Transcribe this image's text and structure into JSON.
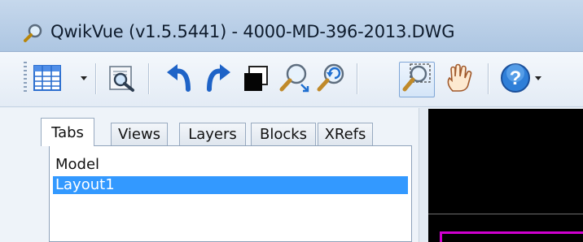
{
  "window": {
    "title": "QwikVue (v1.5.5441) - 4000-MD-396-2013.DWG"
  },
  "toolbar": {
    "buttons": [
      {
        "icon": "grid-table-icon"
      },
      {
        "icon": "print-preview-icon"
      },
      {
        "icon": "undo-icon"
      },
      {
        "icon": "redo-icon"
      },
      {
        "icon": "black-white-icon"
      },
      {
        "icon": "zoom-extents-icon"
      },
      {
        "icon": "zoom-previous-icon"
      },
      {
        "icon": "zoom-window-icon"
      },
      {
        "icon": "pan-hand-icon"
      },
      {
        "icon": "help-icon"
      }
    ]
  },
  "panel": {
    "tabs": [
      {
        "label": "Tabs",
        "selected": true
      },
      {
        "label": "Views",
        "selected": false
      },
      {
        "label": "Layers",
        "selected": false
      },
      {
        "label": "Blocks",
        "selected": false
      },
      {
        "label": "XRefs",
        "selected": false
      }
    ],
    "items": [
      {
        "label": "Model",
        "selected": false
      },
      {
        "label": "Layout1",
        "selected": true
      }
    ]
  },
  "colors": {
    "selection": "#3399ff",
    "viewport_background": "#000000",
    "layout_frame": "#d000d0"
  }
}
